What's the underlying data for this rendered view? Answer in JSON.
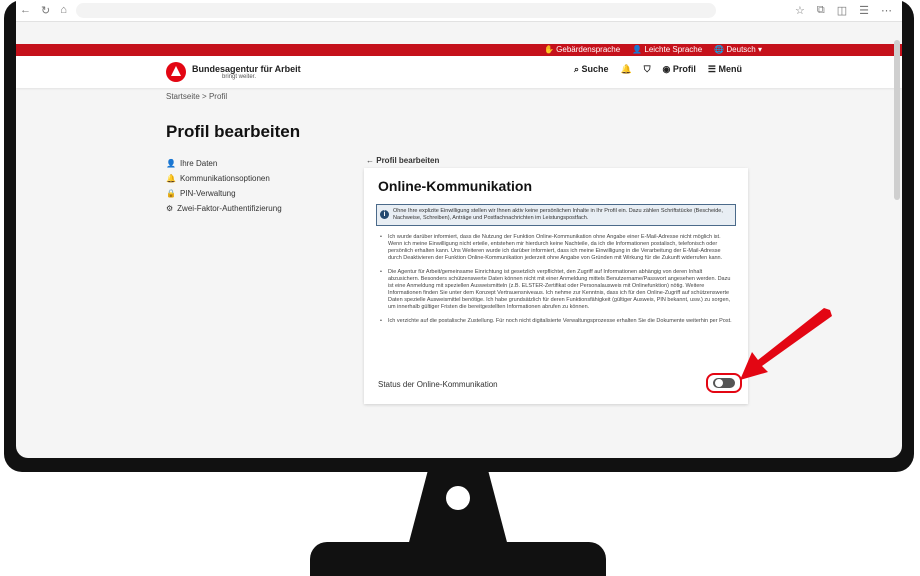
{
  "redbar": {
    "sign_language": "Gebärdensprache",
    "easy_language": "Leichte Sprache",
    "language": "Deutsch"
  },
  "header": {
    "brand": "Bundesagentur für Arbeit",
    "tagline": "bringt weiter.",
    "search": "Suche",
    "profile": "Profil",
    "menu": "Menü"
  },
  "breadcrumb": {
    "home": "Startseite",
    "sep": ">",
    "current": "Profil"
  },
  "page_title": "Profil bearbeiten",
  "sidebar": {
    "items": [
      {
        "label": "Ihre Daten"
      },
      {
        "label": "Kommunikationsoptionen"
      },
      {
        "label": "PIN-Verwaltung"
      },
      {
        "label": "Zwei-Faktor-Authentifizierung"
      }
    ]
  },
  "back_link": "Profil bearbeiten",
  "card": {
    "title": "Online-Kommunikation",
    "info_text": "Ohne Ihre explizite Einwilligung stellen wir Ihnen aktiv keine persönlichen Inhalte in Ihr Profil ein. Dazu zählen Schriftstücke (Bescheide, Nachweise, Schreiben), Anträge und Postfachnachrichten im Leistungspostfach.",
    "bullet_1": "Ich wurde darüber informiert, dass die Nutzung der Funktion Online-Kommunikation ohne Angabe einer E-Mail-Adresse nicht möglich ist. Wenn ich meine Einwilligung nicht erteile, entstehen mir hierdurch keine Nachteile, da ich die Informationen postalisch, telefonisch oder persönlich erhalten kann. Uns Weiteren wurde ich darüber informiert, dass ich meine Einwilligung in die Verarbeitung der E-Mail-Adresse durch Deaktivieren der Funktion Online-Kommunikation jederzeit ohne Angabe von Gründen mit Wirkung für die Zukunft widerrufen kann.",
    "bullet_2": "Die Agentur für Arbeit/gemeinsame Einrichtung ist gesetzlich verpflichtet, den Zugriff auf Informationen abhängig von deren Inhalt abzusichern. Besonders schützenswerte Daten können nicht mit einer Anmeldung mittels Benutzername/Passwort angesehen werden. Dazu ist eine Anmeldung mit speziellen Ausweismitteln (z.B. ELSTER-Zertifikat oder Personalausweis mit Onlinefunktion) nötig. Weitere Informationen finden Sie unter dem Konzept Vertrauensniveaus. Ich nehme zur Kenntnis, dass ich für den Online-Zugriff auf schützenswerte Daten spezielle Ausweismittel benötige. Ich habe grundsätzlich für deren Funktionsfähigkeit (gültiger Ausweis, PIN bekannt, usw.) zu sorgen, um innerhalb gültiger Fristen die bereitgestellten Informationen abrufen zu können.",
    "bullet_3": "Ich verzichte auf die postalische Zustellung. Für noch nicht digitalisierte Verwaltungsprozesse erhalten Sie die Dokumente weiterhin per Post.",
    "status_label": "Status der Online-Kommunikation",
    "toggle_on": false
  },
  "colors": {
    "brand_red": "#c5111b",
    "info_bg": "#e8eef4"
  }
}
